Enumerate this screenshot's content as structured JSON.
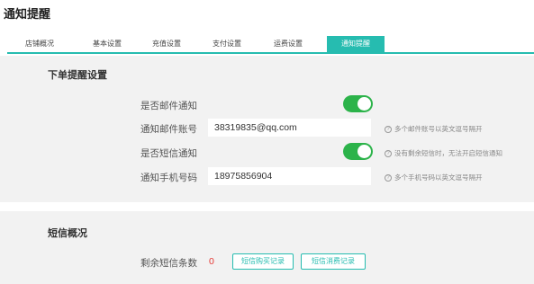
{
  "page_title": "通知提醒",
  "tabs": [
    {
      "label": "店铺概况",
      "active": false
    },
    {
      "label": "基本设置",
      "active": false
    },
    {
      "label": "充值设置",
      "active": false
    },
    {
      "label": "支付设置",
      "active": false
    },
    {
      "label": "运费设置",
      "active": false
    },
    {
      "label": "通知提醒",
      "active": true
    }
  ],
  "order_notify": {
    "title": "下单提醒设置",
    "email_notify_label": "是否邮件通知",
    "email_notify_on": true,
    "email_account_label": "通知邮件账号",
    "email_account_value": "38319835@qq.com",
    "email_hint": "多个邮件账号以英文逗号隔开",
    "sms_notify_label": "是否短信通知",
    "sms_notify_on": true,
    "sms_hint": "没有剩余短信时，无法开启短信通知",
    "phone_label": "通知手机号码",
    "phone_value": "18975856904",
    "phone_hint": "多个手机号码以英文逗号隔开"
  },
  "sms_overview": {
    "title": "短信概况",
    "remaining_label": "剩余短信条数",
    "remaining_count": "0",
    "purchase_button": "短信购买记录",
    "usage_button": "短信消费记录"
  },
  "colors": {
    "accent": "#26bcb0",
    "toggle_on": "#2cb34a",
    "count": "#e53935"
  },
  "icons": {
    "hint": "help-circle-icon"
  }
}
